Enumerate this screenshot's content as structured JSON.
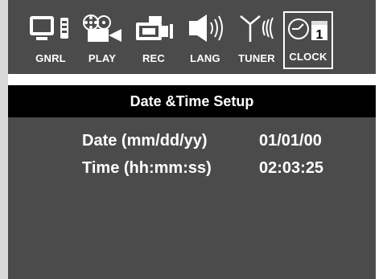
{
  "tabs": [
    {
      "label": "GNRL",
      "icon": "tv-remote-icon",
      "active": false
    },
    {
      "label": "PLAY",
      "icon": "film-reel-icon",
      "active": false
    },
    {
      "label": "REC",
      "icon": "camcorder-icon",
      "active": false
    },
    {
      "label": "LANG",
      "icon": "speaker-icon",
      "active": false
    },
    {
      "label": "TUNER",
      "icon": "antenna-icon",
      "active": false
    },
    {
      "label": "CLOCK",
      "icon": "clock-calendar-icon",
      "active": true
    }
  ],
  "calendar_day": "1",
  "title": "Date &Time Setup",
  "fields": [
    {
      "label": "Date (mm/dd/yy)",
      "value": "01/01/00"
    },
    {
      "label": "Time (hh:mm:ss)",
      "value": "02:03:25"
    }
  ],
  "colors": {
    "panel": "#4b4b4b",
    "title_bar": "#000000",
    "text": "#ffffff"
  }
}
